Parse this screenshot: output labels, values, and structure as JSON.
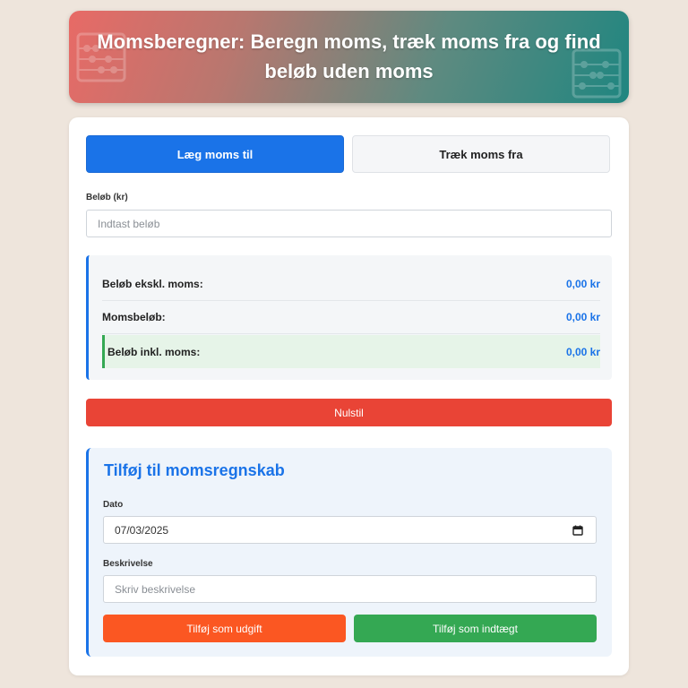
{
  "header": {
    "title": "Momsberegner: Beregn moms, træk moms fra og find beløb uden moms",
    "deco_left_icon": "abacus-icon",
    "deco_right_icon": "abacus-icon"
  },
  "tabs": [
    {
      "label": "Læg moms til",
      "active": true
    },
    {
      "label": "Træk moms fra",
      "active": false
    }
  ],
  "amount": {
    "label": "Beløb (kr)",
    "placeholder": "Indtast beløb",
    "value": ""
  },
  "results": {
    "excl_label": "Beløb ekskl. moms:",
    "excl_value": "0,00 kr",
    "vat_label": "Momsbeløb:",
    "vat_value": "0,00 kr",
    "incl_label": "Beløb inkl. moms:",
    "incl_value": "0,00 kr"
  },
  "reset_label": "Nulstil",
  "ledger": {
    "title": "Tilføj til momsregnskab",
    "date_label": "Dato",
    "date_value": "07/03/2025",
    "date_icon": "calendar-icon",
    "description_label": "Beskrivelse",
    "description_placeholder": "Skriv beskrivelse",
    "expense_label": "Tilføj som udgift",
    "income_label": "Tilføj som indtægt"
  },
  "colors": {
    "primary": "#1a73e8",
    "danger": "#e94436",
    "expense": "#fb5722",
    "income": "#34a853",
    "page_background": "#eee5dc"
  }
}
